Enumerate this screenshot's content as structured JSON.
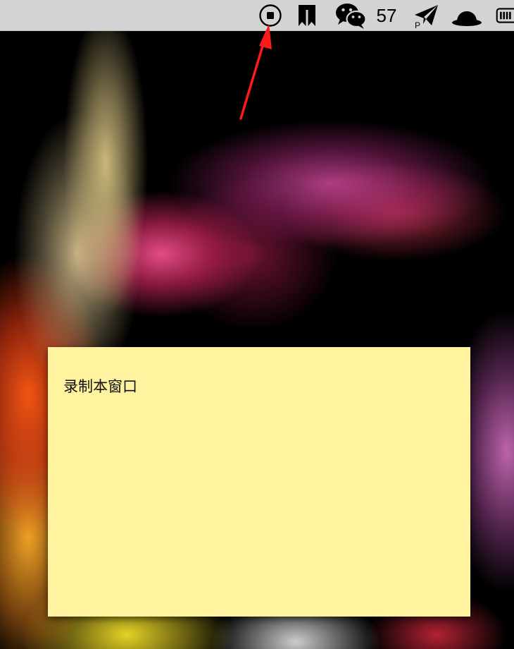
{
  "menubar": {
    "items": [
      {
        "icon": "record-stop-icon"
      },
      {
        "icon": "bookmark-app-icon"
      },
      {
        "icon": "wechat-icon"
      },
      {
        "icon": "paper-plane-icon",
        "sub_label": "P"
      },
      {
        "icon": "bowler-hat-icon"
      },
      {
        "icon": "battery-icon"
      }
    ],
    "notification_count": "57"
  },
  "sticky_note": {
    "text": "录制本窗口",
    "background_color": "#fff39f"
  },
  "annotation": {
    "arrow_color": "#ff1a1a",
    "points_to": "record-stop-icon"
  }
}
